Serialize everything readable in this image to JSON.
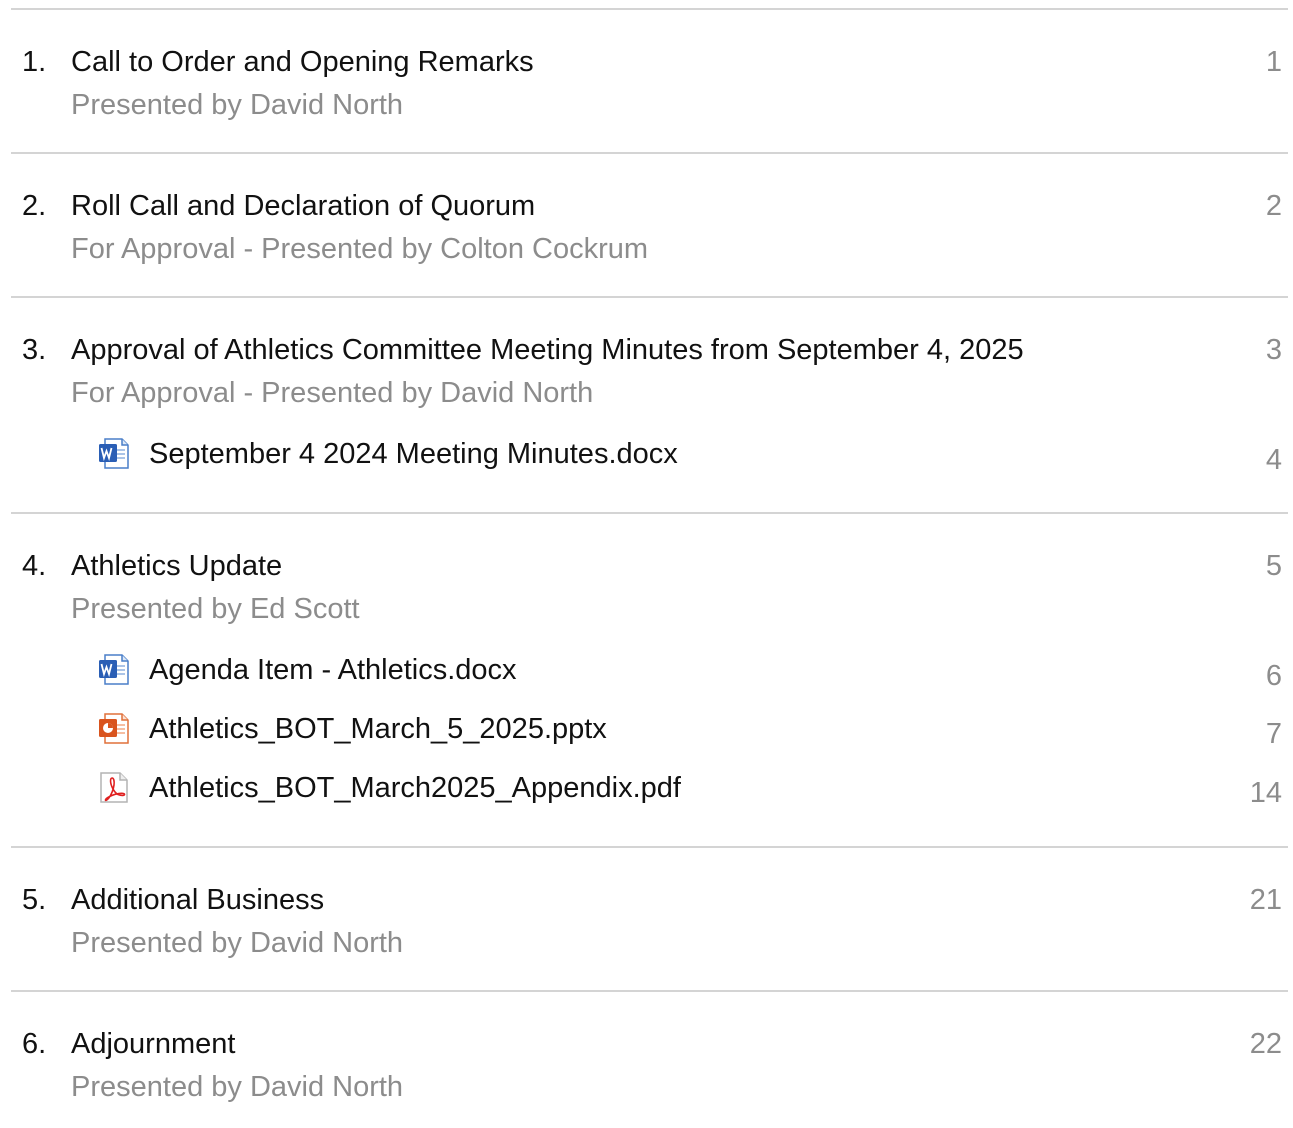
{
  "agenda": {
    "items": [
      {
        "number": "1.",
        "title": "Call to Order and Opening Remarks",
        "subtitle": "Presented by David North",
        "page": "1",
        "attachments": []
      },
      {
        "number": "2.",
        "title": "Roll Call and Declaration of Quorum",
        "subtitle": "For Approval - Presented by Colton Cockrum",
        "page": "2",
        "attachments": []
      },
      {
        "number": "3.",
        "title": "Approval of Athletics Committee Meeting Minutes from September 4, 2025",
        "subtitle": "For Approval - Presented by David North",
        "page": "3",
        "attachments": [
          {
            "icon": "word-doc-icon",
            "name": "September 4 2024 Meeting Minutes.docx",
            "page": "4"
          }
        ]
      },
      {
        "number": "4.",
        "title": "Athletics Update",
        "subtitle": "Presented by Ed Scott",
        "page": "5",
        "attachments": [
          {
            "icon": "word-doc-icon",
            "name": "Agenda Item - Athletics.docx",
            "page": "6"
          },
          {
            "icon": "powerpoint-icon",
            "name": "Athletics_BOT_March_5_2025.pptx",
            "page": "7"
          },
          {
            "icon": "pdf-icon",
            "name": "Athletics_BOT_March2025_Appendix.pdf",
            "page": "14"
          }
        ]
      },
      {
        "number": "5.",
        "title": "Additional Business",
        "subtitle": "Presented by David North",
        "page": "21",
        "attachments": []
      },
      {
        "number": "6.",
        "title": "Adjournment",
        "subtitle": "Presented by David North",
        "page": "22",
        "attachments": []
      }
    ]
  }
}
